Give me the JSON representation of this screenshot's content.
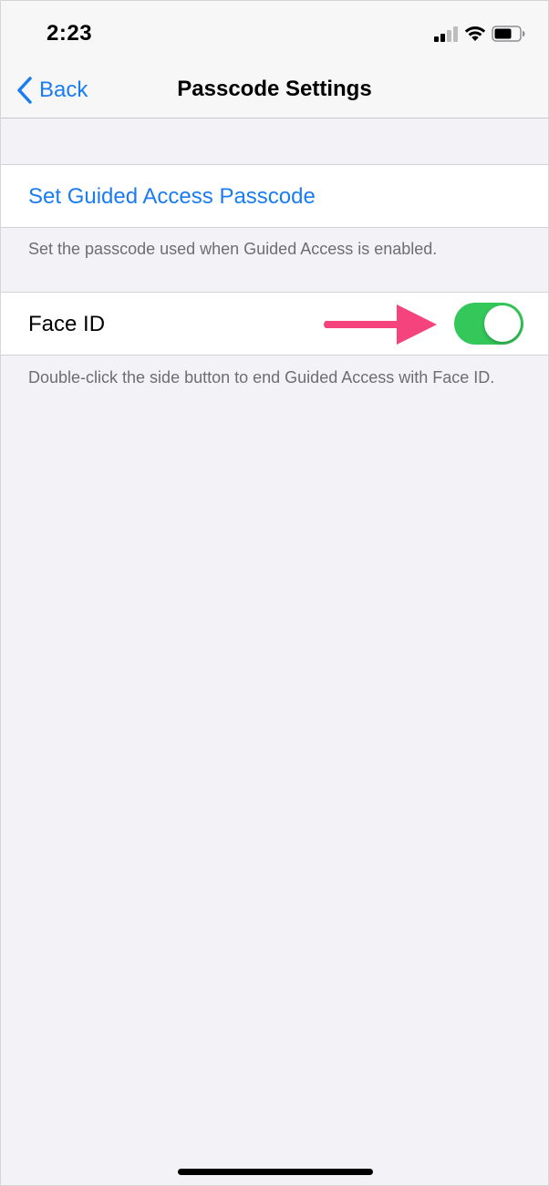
{
  "status_bar": {
    "time": "2:23",
    "icons": [
      "signal-icon",
      "wifi-icon",
      "battery-icon"
    ]
  },
  "nav": {
    "back_label": "Back",
    "title": "Passcode Settings"
  },
  "passcode_group": {
    "label": "Set Guided Access Passcode",
    "footer": "Set the passcode used when Guided Access is enabled."
  },
  "faceid_group": {
    "label": "Face ID",
    "toggle_on": true,
    "footer": "Double-click the side button to end Guided Access with Face ID."
  },
  "colors": {
    "accent": "#1a7cf0",
    "toggle_on": "#34c759",
    "annotation_arrow": "#f5437e",
    "background": "#f2f2f7"
  }
}
